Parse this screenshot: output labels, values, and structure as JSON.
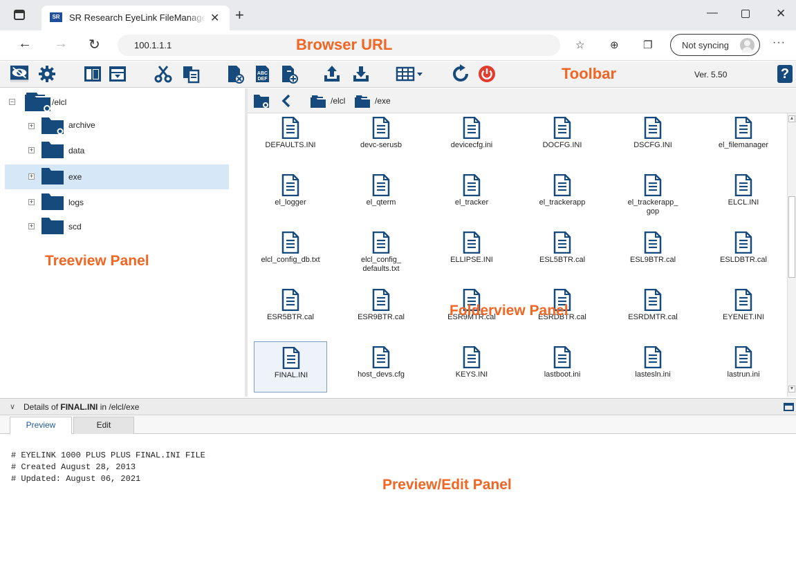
{
  "browser": {
    "tab_title": "SR Research EyeLink FileManager",
    "tab_favicon_text": "SR",
    "url": "100.1.1.1",
    "sync_label": "Not syncing"
  },
  "annotations": {
    "browser_url": "Browser URL",
    "toolbar": "Toolbar",
    "treeview": "Treeview Panel",
    "folderview": "Folderview Panel",
    "preview": "Preview/Edit Panel"
  },
  "toolbar": {
    "version": "Ver. 5.50",
    "help": "?"
  },
  "tree": {
    "root": "/elcl",
    "items": [
      {
        "label": "archive"
      },
      {
        "label": "data"
      },
      {
        "label": "exe"
      },
      {
        "label": "logs"
      },
      {
        "label": "scd"
      }
    ]
  },
  "pathbar": {
    "segments": [
      "/elcl",
      "/exe"
    ]
  },
  "files": [
    {
      "line1": "DEFAULTS.INI"
    },
    {
      "line1": "devc-serusb"
    },
    {
      "line1": "devicecfg.ini"
    },
    {
      "line1": "DOCFG.INI"
    },
    {
      "line1": "DSCFG.INI"
    },
    {
      "line1": "el_filemanager"
    },
    {
      "line1": "el_logger"
    },
    {
      "line1": "el_qterm"
    },
    {
      "line1": "el_tracker"
    },
    {
      "line1": "el_trackerapp"
    },
    {
      "line1": "el_trackerapp_",
      "line2": "gop"
    },
    {
      "line1": "ELCL.INI"
    },
    {
      "line1": "elcl_config_db.txt"
    },
    {
      "line1": "elcl_config_",
      "line2": "defaults.txt"
    },
    {
      "line1": "ELLIPSE.INI"
    },
    {
      "line1": "ESL5BTR.cal"
    },
    {
      "line1": "ESL9BTR.cal"
    },
    {
      "line1": "ESLDBTR.cal"
    },
    {
      "line1": "ESR5BTR.cal"
    },
    {
      "line1": "ESR9BTR.cal"
    },
    {
      "line1": "ESR9MTR.cal"
    },
    {
      "line1": "ESRDBTR.cal"
    },
    {
      "line1": "ESRDMTR.cal"
    },
    {
      "line1": "EYENET.INI"
    },
    {
      "line1": "FINAL.INI",
      "selected": true
    },
    {
      "line1": "host_devs.cfg"
    },
    {
      "line1": "KEYS.INI"
    },
    {
      "line1": "lastboot.ini"
    },
    {
      "line1": "lastesln.ini"
    },
    {
      "line1": "lastrun.ini"
    }
  ],
  "details": {
    "prefix": "Details of ",
    "file": "FINAL.INI",
    "suffix": " in /elcl/exe"
  },
  "tabs": {
    "preview": "Preview",
    "edit": "Edit"
  },
  "preview": {
    "lines": [
      "# EYELINK 1000 PLUS PLUS FINAL.INI FILE",
      "# Created August 28, 2013",
      "# Updated: August 06, 2021"
    ]
  },
  "colors": {
    "accent": "#174a7c",
    "annotation": "#f26522",
    "selection": "#d6e8f7",
    "stop_red": "#e53a2e"
  }
}
